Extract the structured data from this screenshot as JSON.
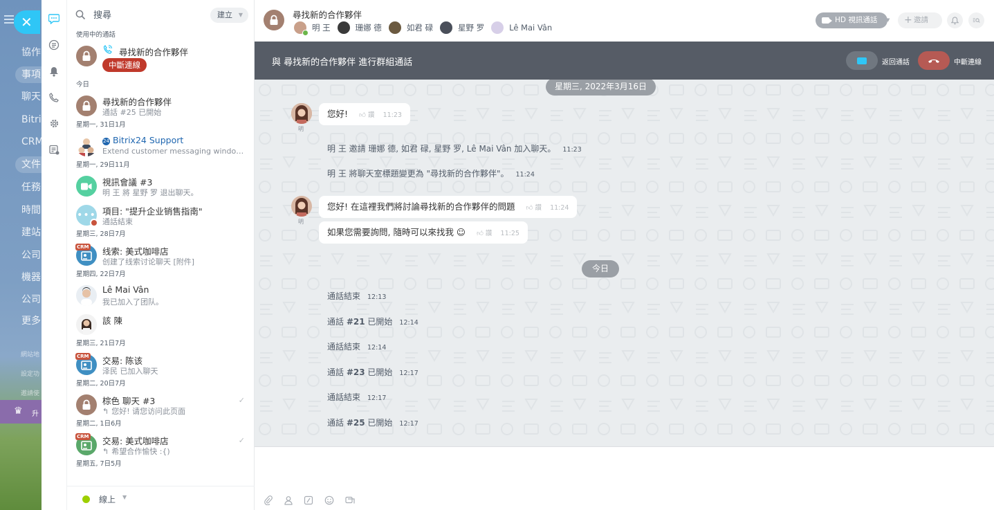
{
  "background": {
    "menu_items": [
      "協作",
      "事項",
      "聊天",
      "Bitrix",
      "CRM",
      "文件",
      "任務",
      "時間",
      "建站",
      "公司",
      "機器",
      "公司",
      "更多"
    ],
    "small_items": [
      "網站地",
      "設定功",
      "邀請使"
    ],
    "promo_text": "升"
  },
  "recent": {
    "search_placeholder": "搜尋",
    "create_label": "建立",
    "active_section": "使用中的通話",
    "active_call": {
      "title": "尋找新的合作夥伴",
      "end_label": "中斷連線"
    },
    "groups": [
      {
        "date": "今日",
        "items": [
          {
            "title": "尋找新的合作夥伴",
            "sub": "通話 #25 已開始",
            "avatar": "lock"
          }
        ]
      },
      {
        "date": "星期一, 31日1月",
        "items": [
          {
            "title": "Bitrix24 Support",
            "sub": "Extend customer messaging window ...",
            "avatar": "support"
          }
        ]
      },
      {
        "date": "星期一, 29日11月",
        "items": [
          {
            "title": "視訊會議 #3",
            "sub": "明 王 將 星野 罗 退出聊天。",
            "avatar": "video"
          },
          {
            "title": "項目: \"提升企业销售指南\"",
            "sub": "通話結束",
            "avatar": "project"
          }
        ]
      },
      {
        "date": "星期三, 28日7月",
        "items": [
          {
            "title": "线索: 美式咖啡店",
            "sub": "创建了线索讨论聊天 [附件]",
            "avatar": "crm"
          }
        ]
      },
      {
        "date": "星期四, 22日7月",
        "items": [
          {
            "title": "Lê Mai Vân",
            "sub": "我已加入了团队。",
            "avatar": "person1"
          },
          {
            "title": "該 陳",
            "sub": "",
            "avatar": "person2"
          }
        ]
      },
      {
        "date": "星期三, 21日7月",
        "items": [
          {
            "title": "交易: 陈该",
            "sub": "泽民 已加入聊天",
            "avatar": "crm"
          }
        ]
      },
      {
        "date": "星期二, 20日7月",
        "items": [
          {
            "title": "棕色 聊天 #3",
            "sub": "您好! 请您访问此页面",
            "avatar": "lock",
            "check": true
          }
        ]
      },
      {
        "date": "星期二, 1日6月",
        "items": [
          {
            "title": "交易: 美式咖啡店",
            "sub": "希望合作愉快 :{)",
            "avatar": "crm-green",
            "check": true
          }
        ]
      },
      {
        "date": "星期五, 7日5月",
        "items": []
      }
    ],
    "status": "線上",
    "crm_badge": "CRM"
  },
  "chat": {
    "title": "尋找新的合作夥伴",
    "members": [
      "明 王",
      "珊娜 德",
      "如君 碌",
      "星野 罗",
      "Lê Mai Vân"
    ],
    "hd_call_label": "HD 視訊通話",
    "invite_label": "邀請",
    "banner_text": "與 尋找新的合作夥伴 進行群組通話",
    "return_label": "返回通話",
    "hangup_label": "中斷連線",
    "date1": "星期三, 2022年3月16日",
    "date2": "今日",
    "avatar_label": "明",
    "like_label": "讚",
    "messages": [
      {
        "text": "您好!",
        "time": "11:23"
      },
      {
        "text": "您好! 在這裡我們將討論尋找新的合作夥伴的問題",
        "time": "11:24"
      },
      {
        "text": "如果您需要詢問, 隨時可以來找我 ☺",
        "time": "11:25"
      }
    ],
    "system": [
      {
        "text": "明 王 邀請 珊娜 德, 如君 碌, 星野 罗, Lê Mai Vân 加入聊天。",
        "time": "11:23"
      },
      {
        "text": "明 王 將聊天室標題變更為 \"尋找新的合作夥伴\"。",
        "time": "11:24"
      }
    ],
    "calls": [
      {
        "pre": "通話結束",
        "num": "",
        "post": "",
        "time": "12:13"
      },
      {
        "pre": "通話 ",
        "num": "#21",
        "post": " 已開始",
        "time": "12:14"
      },
      {
        "pre": "通話結束",
        "num": "",
        "post": "",
        "time": "12:14"
      },
      {
        "pre": "通話 ",
        "num": "#23",
        "post": " 已開始",
        "time": "12:17"
      },
      {
        "pre": "通話結束",
        "num": "",
        "post": "",
        "time": "12:17"
      },
      {
        "pre": "通話 ",
        "num": "#25",
        "post": " 已開始",
        "time": "12:17"
      }
    ]
  },
  "colors": {
    "accent": "#2fc6f6",
    "danger": "#c0392b",
    "online": "#9dcf00",
    "banner": "#565c66"
  }
}
